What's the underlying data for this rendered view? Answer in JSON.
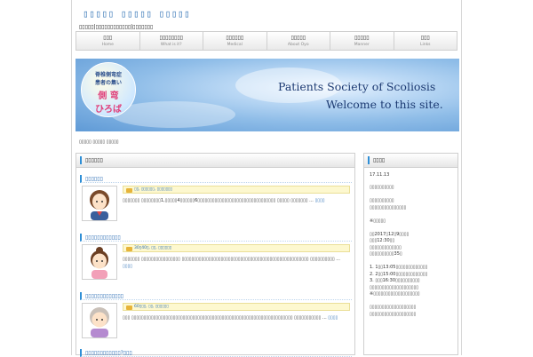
{
  "site": {
    "title": "▯▯▯▯▯ ▯▯▯▯▯ ▯▯▯▯▯",
    "description": "▯▯▯▯▯|▯▯▯▯▯▯▯▯▯▯▯▯|▯▯▯▯▯▯▯"
  },
  "nav": [
    {
      "label": "▯▯▯",
      "sub": "Home"
    },
    {
      "label": "▯▯▯▯▯▯▯▯",
      "sub": "What is it?"
    },
    {
      "label": "▯▯▯▯▯▯",
      "sub": "Medical"
    },
    {
      "label": "▯▯▯▯▯",
      "sub": "About Oyo"
    },
    {
      "label": "▯▯▯▯▯",
      "sub": "Manner"
    },
    {
      "label": "▯▯▯",
      "sub": "Links"
    }
  ],
  "banner": {
    "logo_line1": "脊椎側弯症",
    "logo_line2": "患者の集い",
    "logo_line3": "側 弯",
    "logo_line4": "ひろば",
    "title_line1": "Patients Society of Scoliosis",
    "title_line2": "Welcome to this site."
  },
  "breadcrumb": "▯▯▯▯▯ ▯▯▯▯▯ ▯▯▯▯▯",
  "main": {
    "heading": "▯▯▯▯▯▯",
    "posts": [
      {
        "title": "▯▯▯▯▯▯",
        "meta": "▯▯, ▯▯▯▯▯▯, ▯▯▯▯▯▯▯",
        "excerpt": "▯▯▯▯▯▯▯ ▯▯▯▯▯▯▯▯1,▯▯▯▯▯4▯▯▯▯▯▯6▯▯▯▯▯▯▯▯▯▯▯▯▯▯▯▯▯▯▯▯▯▯▯▯▯▯▯▯▯▯▯▯ ▯▯▯▯▯ ▯▯▯▯▯▯▯ ...",
        "more": "▯▯▯▯"
      },
      {
        "title": "▯▯▯▯▯▯▯▯▯▯▯▯",
        "meta": "30▯40▯, ▯▯, ▯▯▯▯▯▯",
        "excerpt": "▯▯▯▯▯▯▯ ▯▯▯▯▯▯▯▯▯▯▯▯▯▯▯▯ ▯▯▯▯▯▯▯▯▯▯▯▯▯▯▯▯▯▯▯▯▯▯▯▯▯▯▯▯▯▯▯▯▯▯▯▯▯▯▯▯▯▯▯▯▯▯▯▯▯▯▯▯ ▯▯▯▯▯▯▯▯▯▯ ...",
        "more": "▯▯▯▯"
      },
      {
        "title": "▯▯▯▯▯▯▯▯▯▯▯▯▯",
        "meta": "60▯▯▯, ▯▯, ▯▯▯▯▯▯",
        "excerpt": "▯▯▯  ▯▯▯▯▯▯▯▯▯▯▯▯▯▯▯▯▯▯▯▯▯▯▯▯▯▯▯▯▯▯▯▯▯▯▯▯▯▯▯▯▯▯▯▯▯▯▯▯▯▯▯▯▯▯▯▯▯▯▯▯▯▯▯▯▯▯ ▯▯▯▯▯▯▯▯▯▯▯ ...",
        "more": "▯▯▯▯"
      },
      {
        "title": "▯▯▯▯▯▯▯▯▯▯▯▯?▯▯▯",
        "meta": "",
        "excerpt": "",
        "more": ""
      }
    ]
  },
  "sidebar": {
    "heading": "▯▯▯▯",
    "date": "17.11.13",
    "lines": [
      "▯▯▯▯▯▯▯▯▯▯",
      "",
      "▯▯▯▯▯▯▯▯▯▯",
      "▯▯▯▯▯▯▯▯▯▯▯▯▯▯▯",
      "",
      "※▯▯▯▯▯",
      "",
      "▯▯2017▯12▯9▯▯▯▯",
      "▯▯▯12:30▯▯",
      "▯▯▯▯▯▯▯▯▯▯▯▯▯",
      "▯▯▯▯▯▯▯▯▯▯35▯",
      "",
      "1. 1▯▯13:05▯▯▯▯▯▯▯▯▯▯▯▯▯",
      "2. 2▯▯15:00▯▯▯▯▯▯▯▯▯▯▯▯▯",
      "3. ▯▯▯16:30▯▯▯▯▯▯▯▯▯▯",
      "▯▯▯▯▯▯▯▯▯▯▯▯▯▯▯▯▯▯▯▯",
      "※▯▯▯▯▯▯▯▯▯▯▯▯▯▯▯▯▯▯▯",
      "",
      "▯▯▯▯▯▯▯▯▯▯▯▯▯▯▯▯▯▯▯",
      "▯▯▯▯▯▯▯▯▯▯▯▯▯▯▯▯▯▯▯"
    ]
  }
}
